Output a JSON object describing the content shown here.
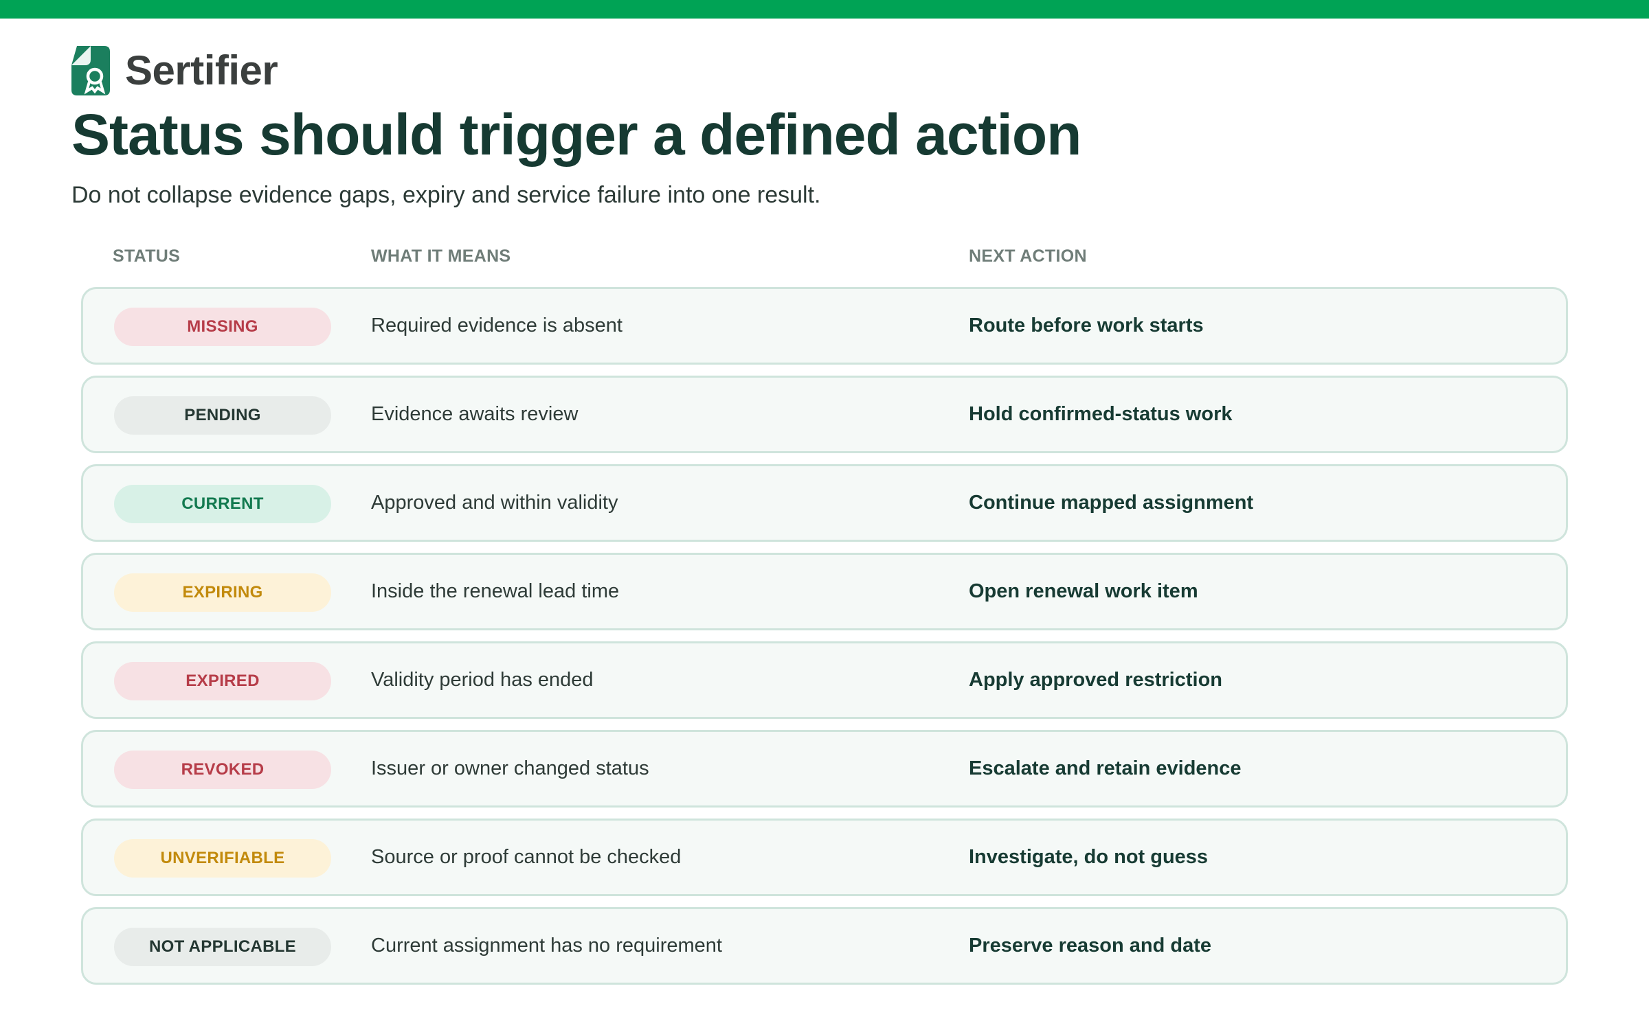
{
  "brand": {
    "name": "Sertifier",
    "logo_icon": "certificate-badge-icon",
    "accent": "#00a355"
  },
  "title": "Status should trigger a defined action",
  "subtitle": "Do not collapse evidence gaps, expiry and service failure into one result.",
  "columns": {
    "status": "STATUS",
    "means": "WHAT IT MEANS",
    "action": "NEXT ACTION"
  },
  "rows": [
    {
      "status": "MISSING",
      "tone": "red",
      "means": "Required evidence is absent",
      "action": "Route before work starts"
    },
    {
      "status": "PENDING",
      "tone": "gray",
      "means": "Evidence awaits review",
      "action": "Hold confirmed-status work"
    },
    {
      "status": "CURRENT",
      "tone": "green",
      "means": "Approved and within validity",
      "action": "Continue mapped assignment"
    },
    {
      "status": "EXPIRING",
      "tone": "amber",
      "means": "Inside the renewal lead time",
      "action": "Open renewal work item"
    },
    {
      "status": "EXPIRED",
      "tone": "red",
      "means": "Validity period has ended",
      "action": "Apply approved restriction"
    },
    {
      "status": "REVOKED",
      "tone": "red",
      "means": "Issuer or owner changed status",
      "action": "Escalate and retain evidence"
    },
    {
      "status": "UNVERIFIABLE",
      "tone": "amber",
      "means": "Source or proof cannot be checked",
      "action": "Investigate, do not guess"
    },
    {
      "status": "NOT APPLICABLE",
      "tone": "gray",
      "means": "Current assignment has no requirement",
      "action": "Preserve reason and date"
    }
  ]
}
